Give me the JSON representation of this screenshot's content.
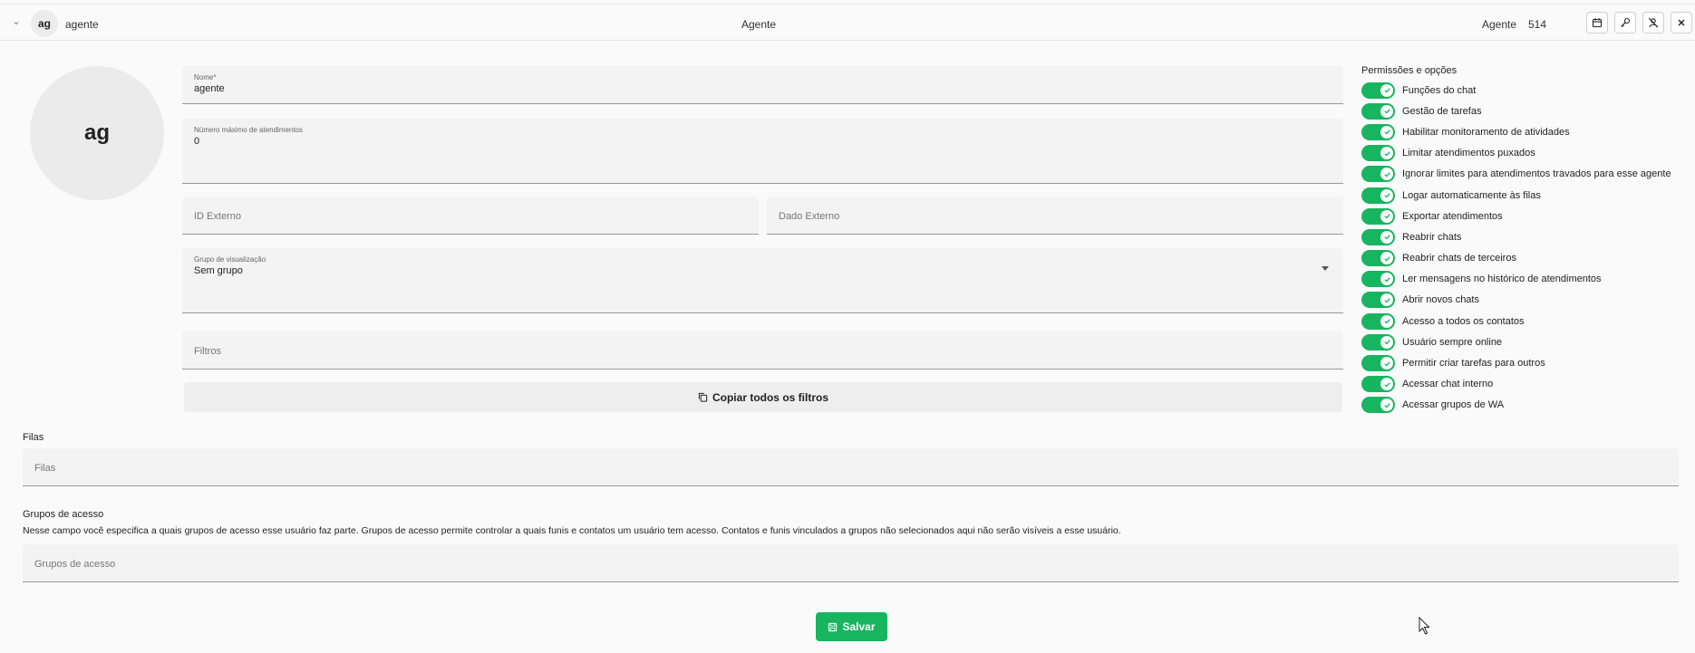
{
  "header": {
    "avatar_initials": "ag",
    "user_name": "agente",
    "center_title": "Agente",
    "role": "Agente",
    "user_id": "514",
    "buttons": [
      {
        "name": "calendar-button",
        "icon": "calendar-icon"
      },
      {
        "name": "key-button",
        "icon": "key-icon"
      },
      {
        "name": "disable-user-button",
        "icon": "user-off-icon"
      },
      {
        "name": "close-button",
        "icon": "close-icon"
      }
    ]
  },
  "profile": {
    "avatar_initials": "ag"
  },
  "form": {
    "name": {
      "label": "Nome*",
      "value": "agente"
    },
    "max_chats": {
      "label": "Número máximo de atendimentos",
      "value": "0"
    },
    "external_id": {
      "placeholder": "ID Externo"
    },
    "external_data": {
      "placeholder": "Dado Externo"
    },
    "view_group": {
      "label": "Grupo de visualização",
      "value": "Sem grupo"
    },
    "filters": {
      "placeholder": "Filtros"
    },
    "copy_filters_label": "Copiar todos os filtros"
  },
  "permissions": {
    "title": "Permissões e opções",
    "items": [
      {
        "label": "Funções do chat",
        "enabled": true
      },
      {
        "label": "Gestão de tarefas",
        "enabled": true
      },
      {
        "label": "Habilitar monitoramento de atividades",
        "enabled": true
      },
      {
        "label": "Limitar atendimentos puxados",
        "enabled": true
      },
      {
        "label": "Ignorar limites para atendimentos travados para esse agente",
        "enabled": true
      },
      {
        "label": "Logar automaticamente às filas",
        "enabled": true
      },
      {
        "label": "Exportar atendimentos",
        "enabled": true
      },
      {
        "label": "Reabrir chats",
        "enabled": true
      },
      {
        "label": "Reabrir chats de terceiros",
        "enabled": true
      },
      {
        "label": "Ler mensagens no histórico de atendimentos",
        "enabled": true
      },
      {
        "label": "Abrir novos chats",
        "enabled": true
      },
      {
        "label": "Acesso a todos os contatos",
        "enabled": true
      },
      {
        "label": "Usuário sempre online",
        "enabled": true
      },
      {
        "label": "Permitir criar tarefas para outros",
        "enabled": true
      },
      {
        "label": "Acessar chat interno",
        "enabled": true
      },
      {
        "label": "Acessar grupos de WA",
        "enabled": true
      }
    ]
  },
  "queues": {
    "title": "Filas",
    "placeholder": "Filas"
  },
  "access_groups": {
    "title": "Grupos de acesso",
    "description": "Nesse campo você especifica a quais grupos de acesso esse usuário faz parte. Grupos de acesso permite controlar a quais funis e contatos um usuário tem acesso. Contatos e funis vinculados a grupos não selecionados aqui não serão visíveis a esse usuário.",
    "placeholder": "Grupos de acesso"
  },
  "save_label": "Salvar",
  "colors": {
    "accent": "#17b55f",
    "field_bg": "#f3f3f3",
    "avatar_bg": "#ebebeb"
  }
}
